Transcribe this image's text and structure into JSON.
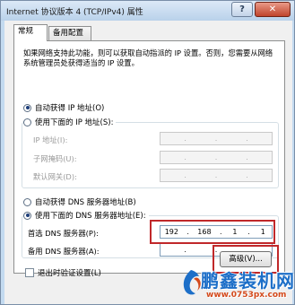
{
  "window": {
    "title": "Internet 协议版本 4 (TCP/IPv4) 属性",
    "help_label": "?",
    "close_label": "✕"
  },
  "tabs": [
    {
      "label": "常规",
      "active": true
    },
    {
      "label": "备用配置",
      "active": false
    }
  ],
  "description": "如果网络支持此功能，则可以获取自动指派的 IP 设置。否则，您需要从网络系统管理员处获得适当的 IP 设置。",
  "ip_section": {
    "auto_label": "自动获得 IP 地址(O)",
    "auto_selected": true,
    "manual_label": "使用下面的 IP 地址(S):",
    "manual_selected": false,
    "fields": [
      {
        "label": "IP 地址(I):",
        "octets": [
          "",
          "",
          "",
          ""
        ]
      },
      {
        "label": "子网掩码(U):",
        "octets": [
          "",
          "",
          "",
          ""
        ]
      },
      {
        "label": "默认网关(D):",
        "octets": [
          "",
          "",
          "",
          ""
        ]
      }
    ]
  },
  "dns_section": {
    "auto_label": "自动获得 DNS 服务器地址(B)",
    "auto_selected": false,
    "manual_label": "使用下面的 DNS 服务器地址(E):",
    "manual_selected": true,
    "preferred": {
      "label": "首选 DNS 服务器(P):",
      "octets": [
        "192",
        "168",
        "1",
        "1"
      ]
    },
    "alternate": {
      "label": "备用 DNS 服务器(A):",
      "octets": [
        "",
        "",
        "",
        ""
      ]
    }
  },
  "validate": {
    "label": "退出时验证设置(L)",
    "checked": false
  },
  "advanced_button": "高级(V)...",
  "watermark": {
    "brand": "鹏鑫装机网",
    "url": "www.0753px.com"
  },
  "colors": {
    "highlight": "#c0282a",
    "title_bar": "#c3daf0",
    "watermark_brand": "#1d6fc8",
    "watermark_url": "#d44a1c"
  }
}
